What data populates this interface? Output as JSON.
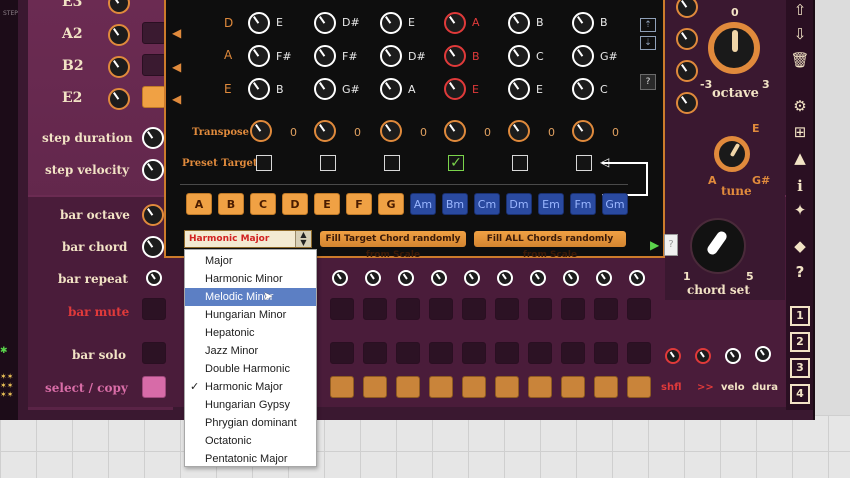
{
  "left": {
    "step_text": "STEP",
    "notes": [
      "E3",
      "A2",
      "B2",
      "E2"
    ],
    "labels": {
      "step_duration": "step duration",
      "step_velocity": "step velocity",
      "bar_octave": "bar octave",
      "bar_chord": "bar chord",
      "bar_repeat": "bar repeat",
      "bar_mute": "bar mute",
      "bar_solo": "bar solo",
      "select_copy": "select / copy"
    }
  },
  "dialog": {
    "rows": [
      {
        "string": "D",
        "notes": [
          "E",
          "D#",
          "E",
          "A",
          "B",
          "B"
        ]
      },
      {
        "string": "A",
        "notes": [
          "F#",
          "F#",
          "D#",
          "B",
          "C",
          "G#"
        ]
      },
      {
        "string": "E",
        "notes": [
          "B",
          "G#",
          "A",
          "E",
          "E",
          "C"
        ]
      }
    ],
    "transpose_label": "Transpose",
    "transpose_values": [
      "0",
      "0",
      "0",
      "0",
      "0",
      "0"
    ],
    "preset_target_label": "Preset Target",
    "preset_checked_index": 3,
    "check_mark": "✓",
    "help_label": "?",
    "major_buttons": [
      "A",
      "B",
      "C",
      "D",
      "E",
      "F",
      "G"
    ],
    "minor_buttons": [
      "Am",
      "Bm",
      "Cm",
      "Dm",
      "Em",
      "Fm",
      "Gm"
    ],
    "scale_select_value": "Harmonic Major",
    "fill_target_label": "Fill Target Chord randomly from Scale",
    "fill_all_label": "Fill ALL Chords randomly from Scale"
  },
  "menu": {
    "items": [
      "Major",
      "Harmonic Minor",
      "Melodic Minor",
      "Hungarian Minor",
      "Hepatonic",
      "Jazz Minor",
      "Double Harmonic",
      "Harmonic Major",
      "Hungarian Gypsy",
      "Phrygian dominant",
      "Octatonic",
      "Pentatonic Major"
    ],
    "hovered_index": 2,
    "checked_index": 7
  },
  "right": {
    "octave_label": "octave",
    "octave_top": "0",
    "octave_min": "-3",
    "octave_max": "3",
    "tune_label": "tune",
    "tune_top": "E",
    "tune_left": "A",
    "tune_right": "G#",
    "chord_set_label": "chord set",
    "chord_set_min": "1",
    "chord_set_max": "5",
    "bottom_labels": [
      "shfl",
      ">>",
      "velo",
      "dura"
    ],
    "slot_numbers": [
      "1",
      "2",
      "3",
      "4"
    ]
  },
  "colors": {
    "accent_orange": "#e08a3c",
    "checked_green": "#7ad44b",
    "mute_red": "#e03a3a",
    "menu_hover": "#5c7fc4"
  }
}
